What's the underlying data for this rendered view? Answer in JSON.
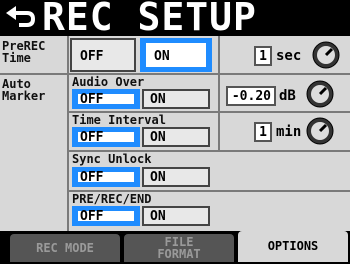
{
  "title": "REC SETUP",
  "prerec": {
    "label": "PreREC\nTime",
    "off": "OFF",
    "on": "ON",
    "selected": "ON",
    "value": "1",
    "unit": "sec"
  },
  "auto_marker": {
    "label": "Auto\nMarker"
  },
  "audio_over": {
    "label": "Audio Over",
    "off": "OFF",
    "on": "ON",
    "selected": "OFF",
    "value": "-0.20",
    "unit": "dB"
  },
  "time_interval": {
    "label": "Time Interval",
    "off": "OFF",
    "on": "ON",
    "selected": "OFF",
    "value": "1",
    "unit": "min"
  },
  "sync_unlock": {
    "label": "Sync Unlock",
    "off": "OFF",
    "on": "ON",
    "selected": "OFF"
  },
  "pre_rec_end": {
    "label": "PRE/REC/END",
    "off": "OFF",
    "on": "ON",
    "selected": "OFF"
  },
  "tabs": [
    {
      "label": "REC MODE",
      "active": false
    },
    {
      "label": "FILE\nFORMAT",
      "active": false
    },
    {
      "label": "OPTIONS",
      "active": true
    }
  ],
  "colors": {
    "selected": "#1f8cff",
    "panel": "#d8d8d8",
    "background": "#000000"
  },
  "icons": {
    "back": "back-arrow-icon",
    "knob": "dial-knob-icon"
  }
}
